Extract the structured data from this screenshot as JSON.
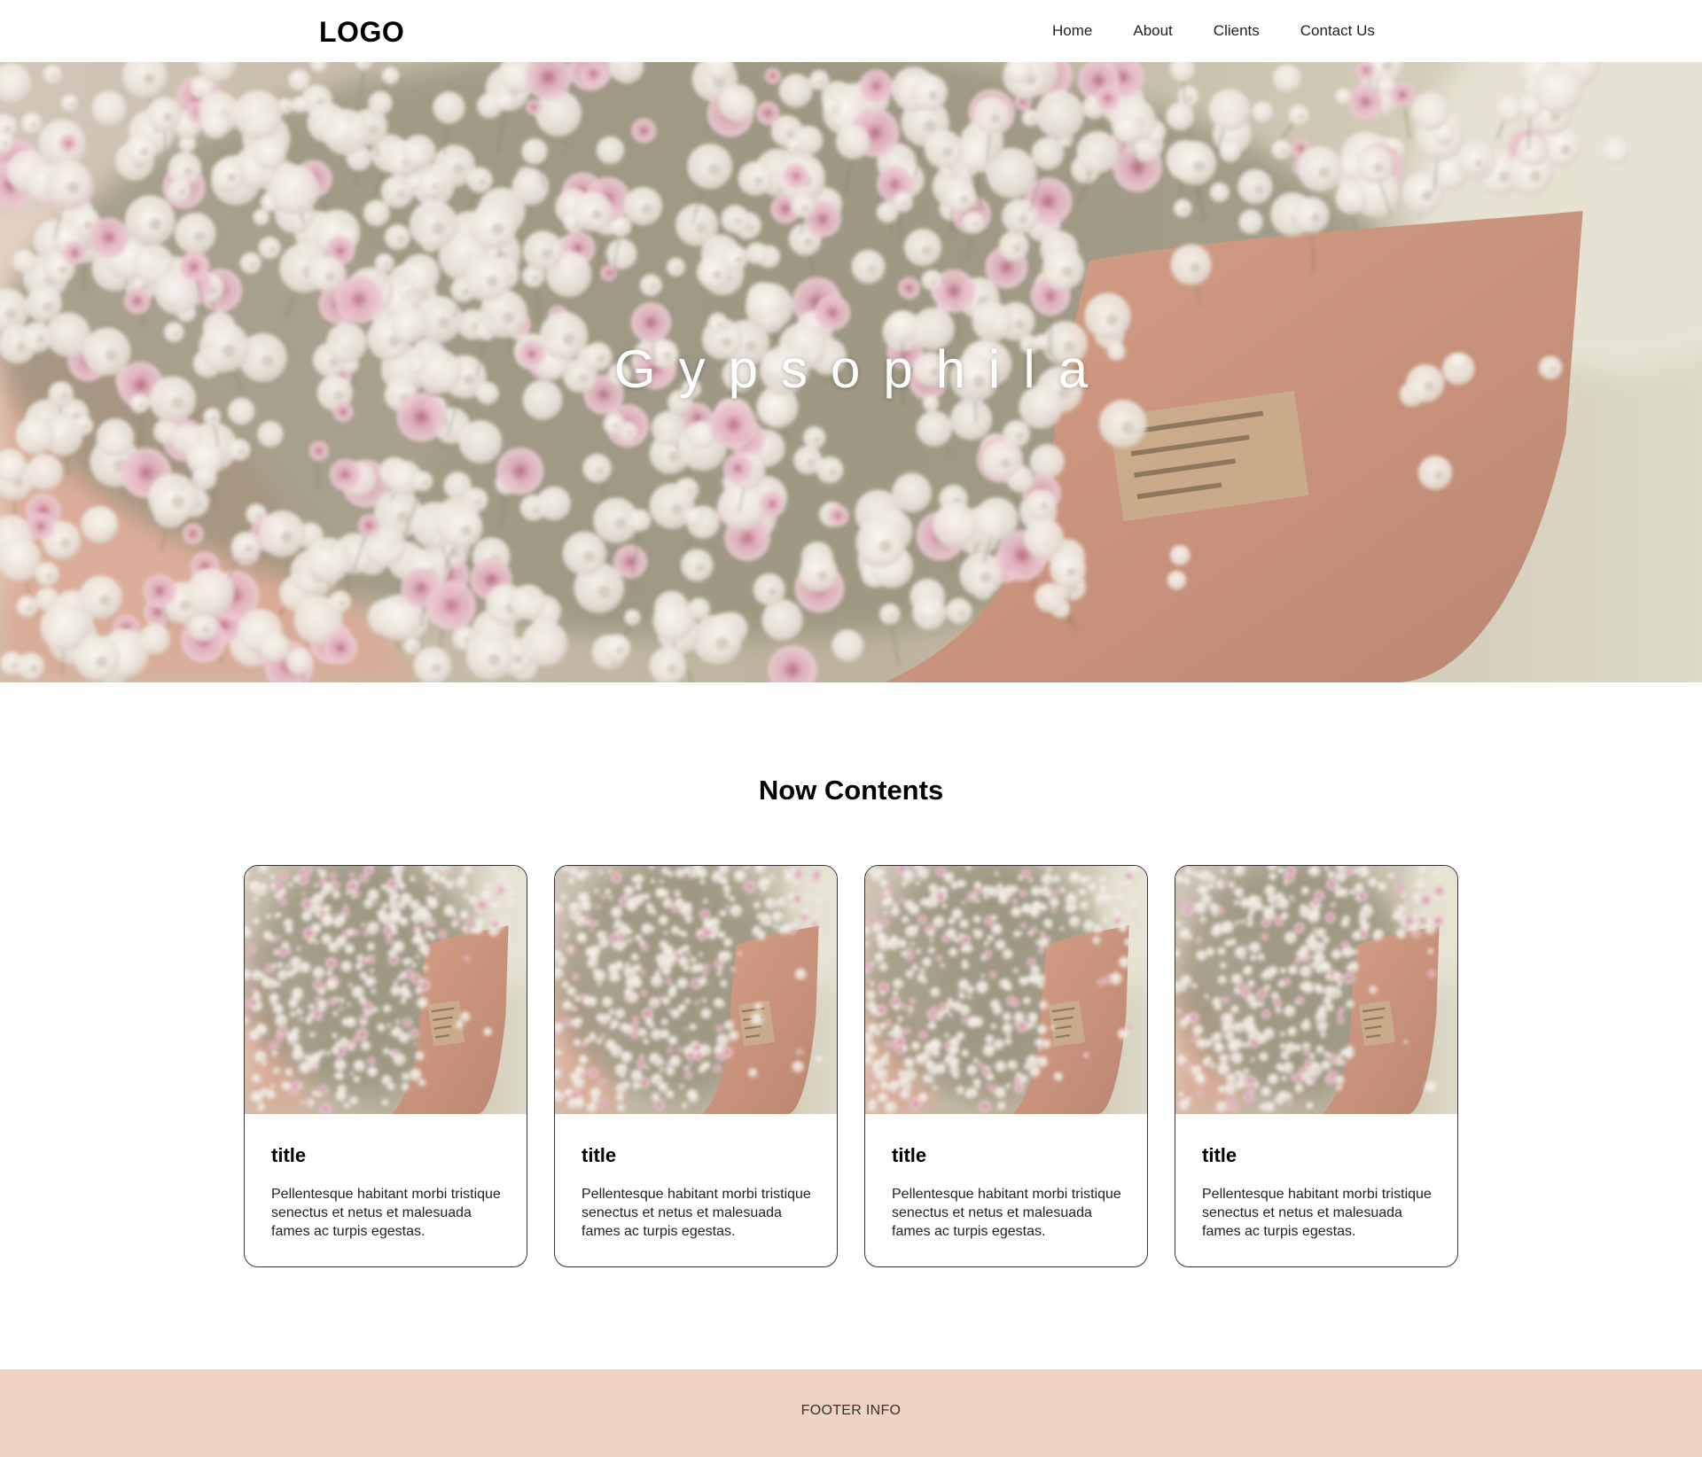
{
  "header": {
    "logo": "LOGO",
    "nav": [
      "Home",
      "About",
      "Clients",
      "Contact Us"
    ]
  },
  "hero": {
    "title": "Gypsophila",
    "image": "gypsophila-bouquet-photo"
  },
  "contents": {
    "heading": "Now Contents",
    "cards": [
      {
        "title": "title",
        "text": "Pellentesque habitant morbi tristique senectus et netus et malesuada fames ac turpis egestas.",
        "image": "gypsophila-bouquet-photo"
      },
      {
        "title": "title",
        "text": "Pellentesque habitant morbi tristique senectus et netus et malesuada fames ac turpis egestas.",
        "image": "gypsophila-bouquet-photo"
      },
      {
        "title": "title",
        "text": "Pellentesque habitant morbi tristique senectus et netus et malesuada fames ac turpis egestas.",
        "image": "gypsophila-bouquet-photo"
      },
      {
        "title": "title",
        "text": "Pellentesque habitant morbi tristique senectus et netus et malesuada fames ac turpis egestas.",
        "image": "gypsophila-bouquet-photo"
      }
    ]
  },
  "footer": {
    "text": "FOOTER INFO"
  },
  "colors": {
    "footer_bg": "#f1d3c3",
    "card_border": "#333333",
    "wrap_paper": "#c98f75"
  }
}
